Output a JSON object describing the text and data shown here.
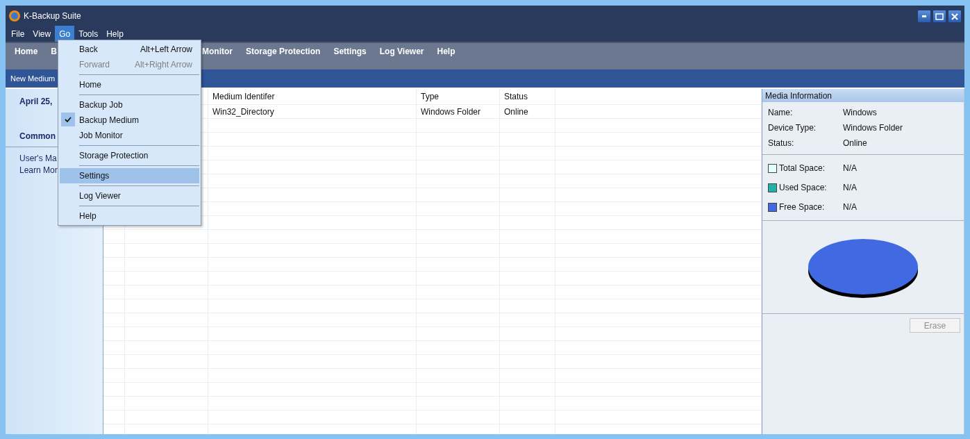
{
  "window": {
    "title": "K-Backup Suite"
  },
  "menu_bar": [
    {
      "label": "File",
      "selected": false
    },
    {
      "label": "View",
      "selected": false
    },
    {
      "label": "Go",
      "selected": true
    },
    {
      "label": "Tools",
      "selected": false
    },
    {
      "label": "Help",
      "selected": false
    }
  ],
  "toolbar": [
    "Home",
    "B",
    "Monitor",
    "Storage Protection",
    "Settings",
    "Log Viewer",
    "Help"
  ],
  "section_bar": {
    "title": "New Medium"
  },
  "sidebar": {
    "date": "April 25,",
    "heading": "Common",
    "links": [
      "User's Ma",
      "Learn Mor"
    ]
  },
  "table": {
    "columns": [
      "",
      "",
      "Medium Identifer",
      "Type",
      "Status"
    ],
    "rows": [
      {
        "cells": [
          "",
          "",
          "Win32_Directory",
          "Windows Folder",
          "Online"
        ]
      }
    ]
  },
  "media_info": {
    "title": "Media Information",
    "details": [
      {
        "label": "Name:",
        "value": "Windows"
      },
      {
        "label": "Device Type:",
        "value": "Windows Folder"
      },
      {
        "label": "Status:",
        "value": "Online"
      }
    ],
    "legend": [
      {
        "label": "Total Space:",
        "value": "N/A",
        "color": "#e0ffff"
      },
      {
        "label": "Used Space:",
        "value": "N/A",
        "color": "#20b2aa"
      },
      {
        "label": "Free Space:",
        "value": "N/A",
        "color": "#4169e1"
      }
    ],
    "erase_button": {
      "label": "Erase",
      "disabled": true
    }
  },
  "go_menu": [
    {
      "kind": "item",
      "label": "Back",
      "shortcut": "Alt+Left Arrow",
      "disabled": false,
      "checked": false,
      "selected": false
    },
    {
      "kind": "item",
      "label": "Forward",
      "shortcut": "Alt+Right Arrow",
      "disabled": true,
      "checked": false,
      "selected": false
    },
    {
      "kind": "separator"
    },
    {
      "kind": "item",
      "label": "Home",
      "disabled": false,
      "checked": false,
      "selected": false
    },
    {
      "kind": "separator"
    },
    {
      "kind": "item",
      "label": "Backup Job",
      "disabled": false,
      "checked": false,
      "selected": false
    },
    {
      "kind": "item",
      "label": "Backup Medium",
      "disabled": false,
      "checked": true,
      "selected": false
    },
    {
      "kind": "item",
      "label": "Job Monitor",
      "disabled": false,
      "checked": false,
      "selected": false
    },
    {
      "kind": "separator"
    },
    {
      "kind": "item",
      "label": "Storage Protection",
      "disabled": false,
      "checked": false,
      "selected": false
    },
    {
      "kind": "separator"
    },
    {
      "kind": "item",
      "label": "Settings",
      "disabled": false,
      "checked": false,
      "selected": true
    },
    {
      "kind": "separator"
    },
    {
      "kind": "item",
      "label": "Log Viewer",
      "disabled": false,
      "checked": false,
      "selected": false
    },
    {
      "kind": "separator"
    },
    {
      "kind": "item",
      "label": "Help",
      "disabled": false,
      "checked": false,
      "selected": false
    }
  ]
}
